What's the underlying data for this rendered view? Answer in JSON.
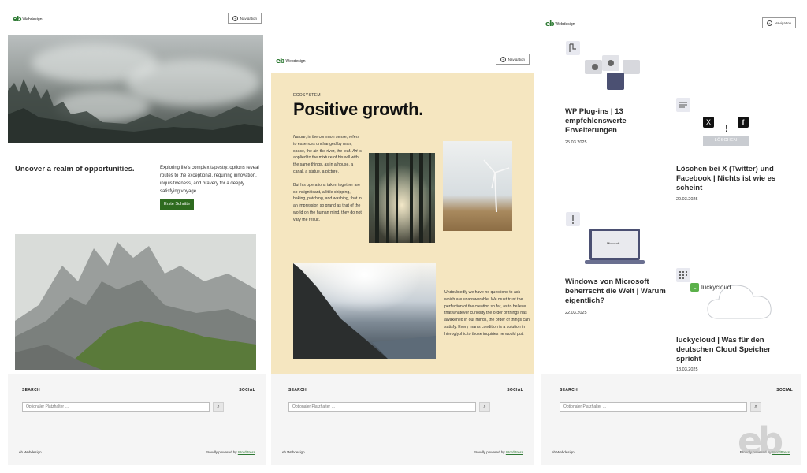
{
  "brand": {
    "logo_mark": "eb",
    "name": "Webdesign"
  },
  "header": {
    "nav_label": "Navigation",
    "nav_icon": "plus-circle-icon"
  },
  "footer": {
    "search_label": "SEARCH",
    "social_label": "SOCIAL",
    "search_placeholder": "Optionaler Platzhalter …",
    "search_icon": "magnifier-icon",
    "brand_text": "eb Webdesign",
    "powered_prefix": "Proudly powered by ",
    "powered_link": "WordPress"
  },
  "panel1": {
    "heading": "Uncover a realm of opportunities.",
    "text": "Exploring life's complex tapestry, options reveal routes to the exceptional, requiring innovation, inquisitiveness, and bravery for a deeply satisfying voyage.",
    "cta_label": "Erste Schritte"
  },
  "panel2": {
    "eyebrow": "ECOSYSTEM",
    "title": "Positive growth.",
    "text1_p1_em1": "Nature",
    "text1_p1_a": ", in the common sense, refers to essences unchanged by man; space, the air, the river, the leaf. ",
    "text1_p1_em2": "Art",
    "text1_p1_b": " is applied to the mixture of his will with the same things, as in a house, a canal, a statue, a picture.",
    "text1_p2": "But his operations taken together are so insignificant, a little chipping, baking, patching, and washing, that in an impression so grand as that of the world on the human mind, they do not vary the result.",
    "text2": "Undoubtedly we have no questions to ask which are unanswerable. We must trust the perfection of the creation so far, as to believe that whatever curiosity the order of things has awakened in our minds, the order of things can satisfy. Every man's condition is a solution in hieroglyphic to those inquiries he would put."
  },
  "panel3": {
    "cards": [
      {
        "title": "WP Plug-ins | 13 empfehlenswerte Erweiterungen",
        "date": "25.03.2025",
        "icon": "plugin-icon"
      },
      {
        "title": "Löschen bei X (Twitter) und Facebook | Nichts ist wie es scheint",
        "date": "20.03.2025",
        "icon": "lines-icon"
      },
      {
        "title": "Windows von Microsoft beherrscht die Welt | Warum eigentlich?",
        "date": "22.03.2025",
        "icon": "exclamation-icon"
      },
      {
        "title": "luckycloud | Was für den deutschen Cloud Speicher spricht",
        "date": "18.03.2025",
        "icon": "grid-icon"
      }
    ],
    "delete_button": "LÖSCHEN",
    "social_x": "X",
    "social_fb": "f",
    "exclamation": "!",
    "laptop_brand": "Microsoft",
    "lucky_brand": "luckycloud",
    "lucky_logo": "L"
  },
  "colors": {
    "accent_green": "#2e6b1f",
    "panel2_bg": "#f5e6c0",
    "footer_bg": "#f5f5f5"
  }
}
